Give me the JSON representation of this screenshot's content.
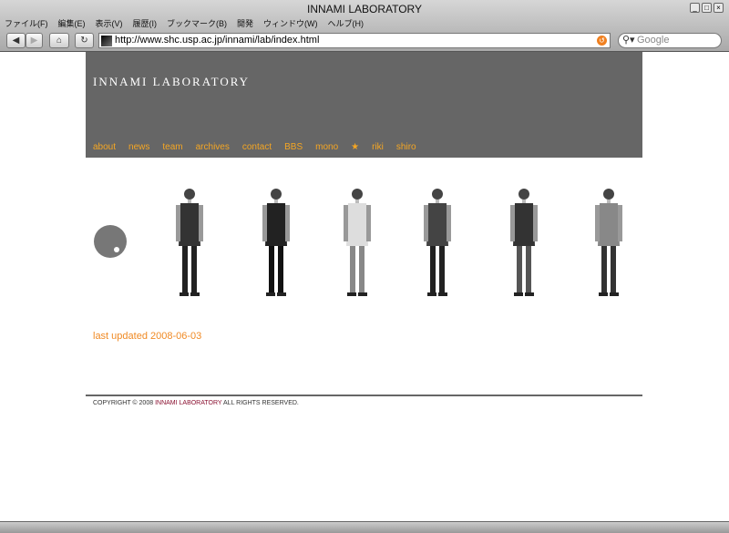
{
  "window": {
    "title": "INNAMI LABORATORY"
  },
  "menu": [
    "ファイル(F)",
    "編集(E)",
    "表示(V)",
    "履歴(I)",
    "ブックマーク(B)",
    "開発",
    "ウィンドウ(W)",
    "ヘルプ(H)"
  ],
  "toolbar": {
    "url": "http://www.shc.usp.ac.jp/innami/lab/index.html",
    "search_placeholder": "Google"
  },
  "site": {
    "title": "INNAMI LABORATORY",
    "nav": [
      "about",
      "news",
      "team",
      "archives",
      "contact",
      "BBS",
      "mono",
      "★",
      "riki",
      "shiro"
    ],
    "last_updated": "last updated 2008-06-03",
    "copyright_pre": "COPYRIGHT © 2008 ",
    "copyright_lab": "INNAMI LABORATORY",
    "copyright_post": " ALL RIGHTS RESERVED."
  },
  "colors": {
    "accent": "#f5a623",
    "header": "#666666"
  }
}
